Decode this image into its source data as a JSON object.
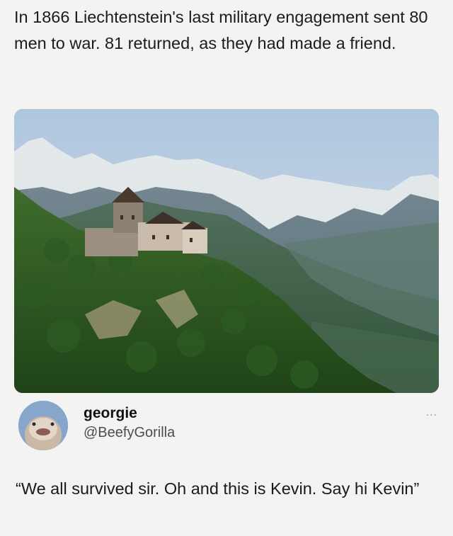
{
  "post": {
    "text": "In 1866 Liechtenstein's last military engagement sent 80 men to war. 81 returned, as they had made a friend."
  },
  "photo": {
    "alt_icon": "castle-mountain-photo"
  },
  "reply": {
    "display_name": "georgie",
    "handle": "@BeefyGorilla",
    "more_label": "...",
    "text": "“We all survived sir. Oh and this is Kevin. Say hi Kevin”"
  },
  "colors": {
    "background": "#f3f3f1",
    "text": "#1a1a1a",
    "handle": "#4d4d4d"
  }
}
